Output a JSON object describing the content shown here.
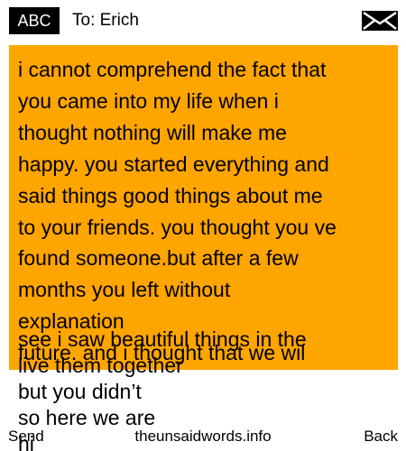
{
  "header": {
    "input_mode": "ABC",
    "to_label": "To: Erich",
    "message_icon": "envelope-icon"
  },
  "message": {
    "body": "i cannot comprehend the fact that\nyou came into my life when i\nthought nothing will make me\nhappy. you started everything and\nsaid things good things about me\nto your friends. you thought you ve\nfound someone.but after a few\nmonths you left without\nexplanation\nfuture. and i thought that we wil",
    "overflow_text": "see i saw beautiful things in the\nlive them together\nbut you didn’t\nso here we are\nhi",
    "background_color": "#ffa500"
  },
  "softkeys": {
    "left_label": "Send",
    "center_label": "theunsaidwords.info",
    "right_label": "Back"
  }
}
